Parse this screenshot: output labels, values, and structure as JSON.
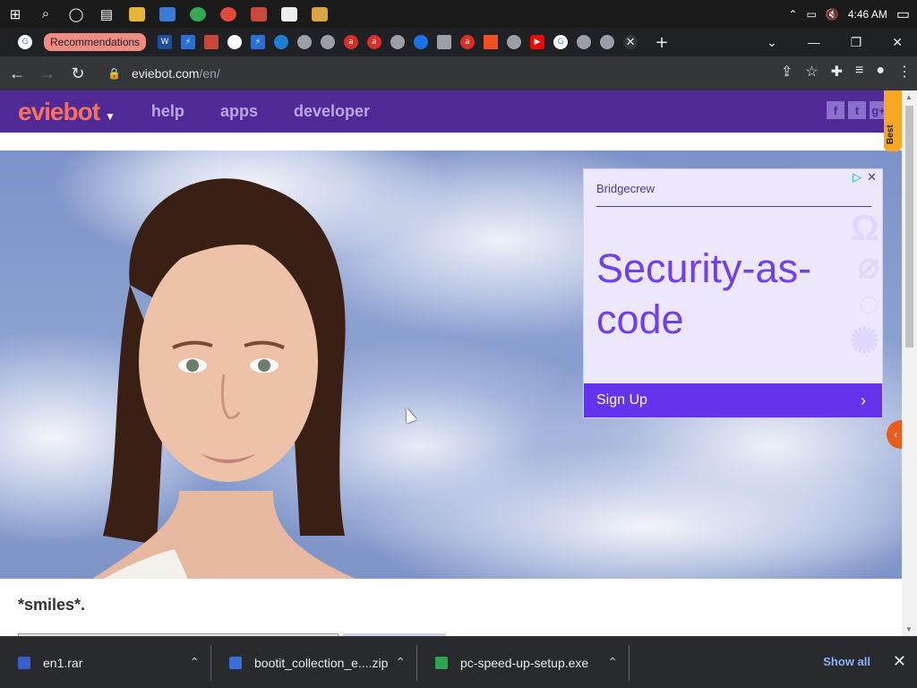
{
  "taskbar": {
    "time": "4:46 AM",
    "apps": [
      "start",
      "search",
      "cortana",
      "task-view",
      "file-explorer",
      "store",
      "chrome",
      "app1",
      "app2",
      "app3",
      "app4"
    ]
  },
  "tabs": {
    "recommendations_label": "Recommendations",
    "new_tab_icon": "+",
    "minimize": "—",
    "maximize": "❐",
    "close": "✕"
  },
  "address": {
    "domain": "eviebot.com",
    "path": "/en/"
  },
  "site": {
    "logo": "eviebot",
    "nav": [
      "help",
      "apps",
      "developer"
    ],
    "social": [
      "f",
      "t",
      "g+"
    ],
    "best_label": "Best"
  },
  "ad": {
    "brand": "Bridgecrew",
    "headline": "Security-as-code",
    "cta": "Sign Up"
  },
  "caption": "*smiles*.",
  "downloads": {
    "items": [
      {
        "name": "en1.rar",
        "color": "#3b5ccc"
      },
      {
        "name": "bootit_collection_e....zip",
        "color": "#3a6fd8"
      },
      {
        "name": "pc-speed-up-setup.exe",
        "color": "#2ea44f"
      }
    ],
    "show_all": "Show all"
  }
}
